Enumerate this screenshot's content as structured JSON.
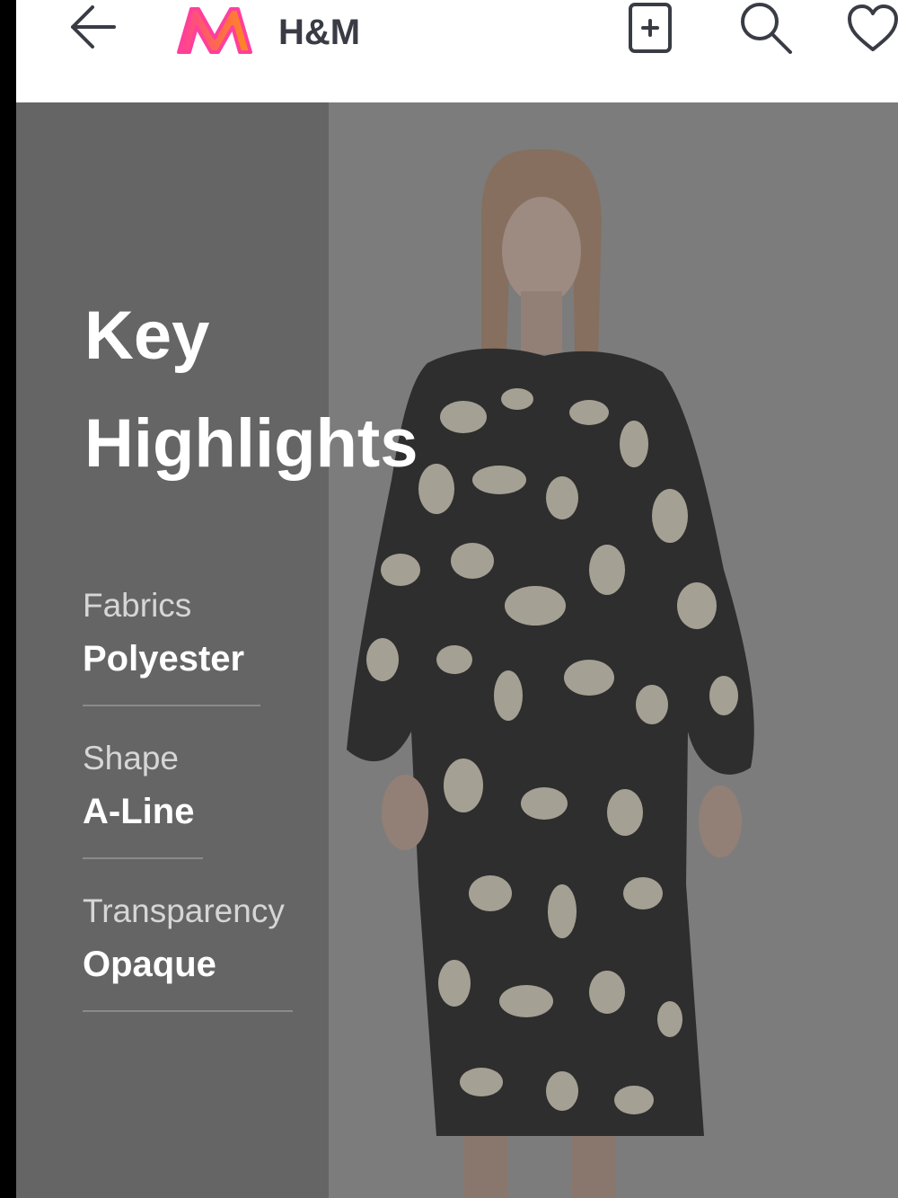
{
  "header": {
    "back_icon": "arrow-left-icon",
    "logo": "myntra-m-logo",
    "brand": "H&M",
    "icons": [
      "add-to-bag-icon",
      "search-icon",
      "heart-icon"
    ]
  },
  "highlights": {
    "title_line1": "Key",
    "title_line2": "Highlights",
    "items": [
      {
        "label": "Fabrics",
        "value": "Polyester"
      },
      {
        "label": "Shape",
        "value": "A-Line"
      },
      {
        "label": "Transparency",
        "value": "Opaque"
      }
    ]
  },
  "product_image": "model wearing black and cream printed dress with balloon sleeves",
  "colors": {
    "panel": "#656565",
    "overlay": "#7d7d7d",
    "logo_pink": "#ff3f9a",
    "logo_orange": "#ff8a1e"
  }
}
